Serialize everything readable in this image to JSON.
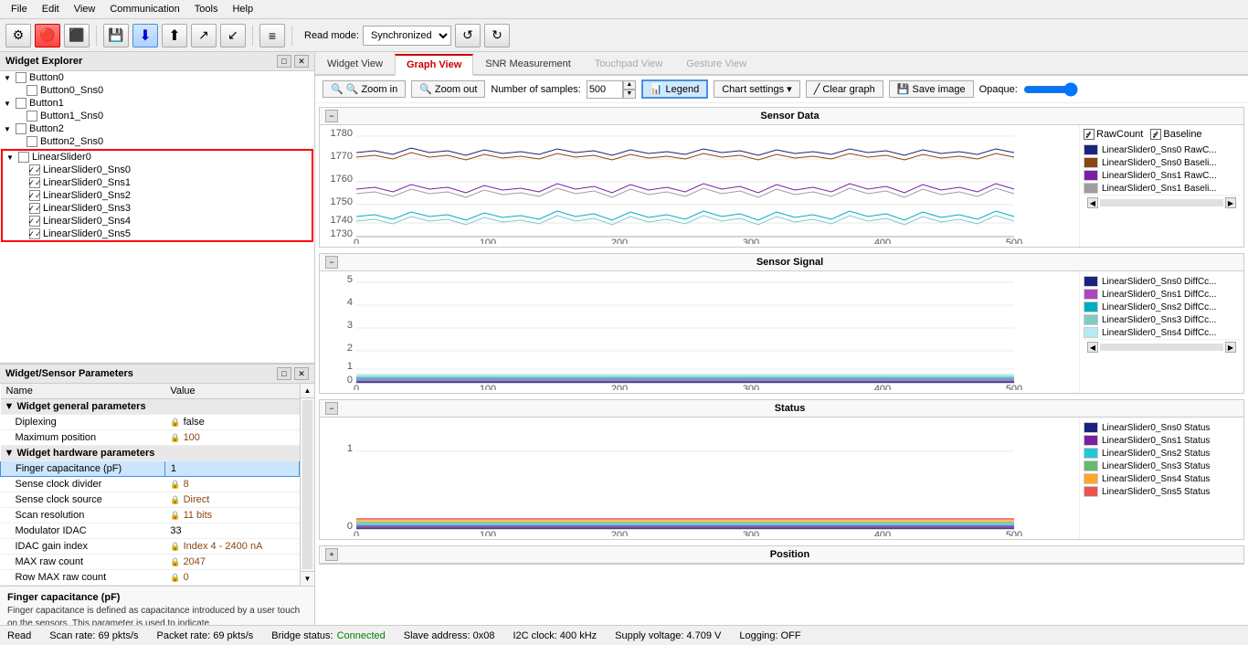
{
  "menubar": {
    "items": [
      "File",
      "Edit",
      "View",
      "Communication",
      "Tools",
      "Help"
    ]
  },
  "toolbar": {
    "read_mode_label": "Read mode:",
    "read_mode_value": "Synchronized",
    "undo_label": "↺",
    "redo_label": "↻"
  },
  "left_panel": {
    "widget_explorer": {
      "title": "Widget Explorer",
      "tree": [
        {
          "id": "Button0",
          "label": "Button0",
          "indent": 0,
          "type": "parent",
          "expanded": true
        },
        {
          "id": "Button0_Sns0",
          "label": "Button0_Sns0",
          "indent": 1,
          "type": "leaf"
        },
        {
          "id": "Button1",
          "label": "Button1",
          "indent": 0,
          "type": "parent",
          "expanded": true
        },
        {
          "id": "Button1_Sns0",
          "label": "Button1_Sns0",
          "indent": 1,
          "type": "leaf"
        },
        {
          "id": "Button2",
          "label": "Button2",
          "indent": 0,
          "type": "parent",
          "expanded": true
        },
        {
          "id": "Button2_Sns0",
          "label": "Button2_Sns0",
          "indent": 1,
          "type": "leaf"
        },
        {
          "id": "LinearSlider0",
          "label": "LinearSlider0",
          "indent": 0,
          "type": "parent",
          "expanded": true,
          "selected": true
        },
        {
          "id": "LinearSlider0_Sns0",
          "label": "LinearSlider0_Sns0",
          "indent": 1,
          "type": "leaf",
          "checked": true
        },
        {
          "id": "LinearSlider0_Sns1",
          "label": "LinearSlider0_Sns1",
          "indent": 1,
          "type": "leaf",
          "checked": true
        },
        {
          "id": "LinearSlider0_Sns2",
          "label": "LinearSlider0_Sns2",
          "indent": 1,
          "type": "leaf",
          "checked": true
        },
        {
          "id": "LinearSlider0_Sns3",
          "label": "LinearSlider0_Sns3",
          "indent": 1,
          "type": "leaf",
          "checked": true
        },
        {
          "id": "LinearSlider0_Sns4",
          "label": "LinearSlider0_Sns4",
          "indent": 1,
          "type": "leaf",
          "checked": true
        },
        {
          "id": "LinearSlider0_Sns5",
          "label": "LinearSlider0_Sns5",
          "indent": 1,
          "type": "leaf",
          "checked": true
        }
      ]
    },
    "params_panel": {
      "title": "Widget/Sensor Parameters",
      "columns": [
        "Name",
        "Value"
      ],
      "sections": [
        {
          "type": "section",
          "label": "Widget general parameters"
        },
        {
          "name": "Diplexing",
          "value": "false",
          "locked": true,
          "indent": 1
        },
        {
          "name": "Maximum position",
          "value": "100",
          "locked": true,
          "indent": 1
        },
        {
          "type": "section",
          "label": "Widget hardware parameters"
        },
        {
          "name": "Finger capacitance (pF)",
          "value": "1",
          "locked": false,
          "highlighted": true,
          "indent": 1
        },
        {
          "name": "Sense clock divider",
          "value": "8",
          "locked": true,
          "indent": 1
        },
        {
          "name": "Sense clock source",
          "value": "Direct",
          "locked": true,
          "indent": 1
        },
        {
          "name": "Scan resolution",
          "value": "11 bits",
          "locked": true,
          "indent": 1
        },
        {
          "name": "Modulator IDAC",
          "value": "33",
          "locked": false,
          "indent": 1
        },
        {
          "name": "IDAC gain index",
          "value": "Index 4 - 2400 nA",
          "locked": true,
          "indent": 1
        },
        {
          "name": "MAX raw count",
          "value": "2047",
          "locked": true,
          "indent": 1
        },
        {
          "name": "Row MAX raw count",
          "value": "0",
          "locked": true,
          "indent": 1
        }
      ]
    },
    "info_box": {
      "title": "Finger capacitance (pF)",
      "text": "Finger capacitance is defined as capacitance introduced by a user touch on the sensors. This parameter is used to indicate"
    }
  },
  "right_panel": {
    "tabs": [
      {
        "label": "Widget View",
        "state": "inactive"
      },
      {
        "label": "Graph View",
        "state": "active"
      },
      {
        "label": "SNR Measurement",
        "state": "inactive"
      },
      {
        "label": "Touchpad View",
        "state": "disabled"
      },
      {
        "label": "Gesture View",
        "state": "disabled"
      }
    ],
    "graph_toolbar": {
      "zoom_in": "🔍 Zoom in",
      "zoom_out": "🔍 Zoom out",
      "samples_label": "Number of samples:",
      "samples_value": "500",
      "legend_label": "Legend",
      "chart_settings": "Chart settings",
      "clear_graph": "Clear graph",
      "save_image": "Save image",
      "opaque_label": "Opaque:"
    },
    "graphs": [
      {
        "id": "sensor_data",
        "title": "Sensor Data",
        "collapsed": false,
        "y_min": 1730,
        "y_max": 1780,
        "y_ticks": [
          1730,
          1740,
          1750,
          1760,
          1770,
          1780
        ],
        "x_ticks": [
          0,
          100,
          200,
          300,
          400,
          500
        ],
        "legend": [
          {
            "label": "LinearSlider0_Sns0 RawC...",
            "color": "#1a237e"
          },
          {
            "label": "LinearSlider0_Sns0 Baseli...",
            "color": "#8B4513"
          },
          {
            "label": "LinearSlider0_Sns1 RawC...",
            "color": "#7B1FA2"
          },
          {
            "label": "LinearSlider0_Sns1 Baseli...",
            "color": "#9E9E9E"
          }
        ],
        "checkboxes": [
          {
            "label": "RawCount",
            "checked": true
          },
          {
            "label": "Baseline",
            "checked": true
          }
        ]
      },
      {
        "id": "sensor_signal",
        "title": "Sensor Signal",
        "collapsed": false,
        "y_min": 0,
        "y_max": 5,
        "y_ticks": [
          0,
          1,
          2,
          3,
          4,
          5
        ],
        "x_ticks": [
          0,
          100,
          200,
          300,
          400,
          500
        ],
        "legend": [
          {
            "label": "LinearSlider0_Sns0 DiffCc...",
            "color": "#1a237e"
          },
          {
            "label": "LinearSlider0_Sns1 DiffCc...",
            "color": "#AB47BC"
          },
          {
            "label": "LinearSlider0_Sns2 DiffCc...",
            "color": "#00ACC1"
          },
          {
            "label": "LinearSlider0_Sns3 DiffCc...",
            "color": "#80CBC4"
          },
          {
            "label": "LinearSlider0_Sns4 DiffCc...",
            "color": "#B2EBF2"
          }
        ],
        "checkboxes": []
      },
      {
        "id": "status",
        "title": "Status",
        "collapsed": false,
        "y_min": 0,
        "y_max": 1,
        "y_ticks": [
          0,
          1
        ],
        "x_ticks": [
          0,
          100,
          200,
          300,
          400,
          500
        ],
        "legend": [
          {
            "label": "LinearSlider0_Sns0 Status",
            "color": "#1a237e"
          },
          {
            "label": "LinearSlider0_Sns1 Status",
            "color": "#7B1FA2"
          },
          {
            "label": "LinearSlider0_Sns2 Status",
            "color": "#26C6DA"
          },
          {
            "label": "LinearSlider0_Sns3 Status",
            "color": "#66BB6A"
          },
          {
            "label": "LinearSlider0_Sns4 Status",
            "color": "#FFA726"
          },
          {
            "label": "LinearSlider0_Sns5 Status",
            "color": "#EF5350"
          }
        ],
        "checkboxes": []
      },
      {
        "id": "position",
        "title": "Position",
        "collapsed": true,
        "legend": []
      }
    ]
  },
  "status_bar": {
    "mode": "Read",
    "scan_rate": "Scan rate: 69 pkts/s",
    "packet_rate": "Packet rate: 69 pkts/s",
    "bridge_status_label": "Bridge status:",
    "bridge_status_value": "Connected",
    "slave_address": "Slave address: 0x08",
    "i2c_clock": "I2C clock: 400 kHz",
    "supply_voltage": "Supply voltage: 4.709 V",
    "logging": "Logging: OFF"
  }
}
